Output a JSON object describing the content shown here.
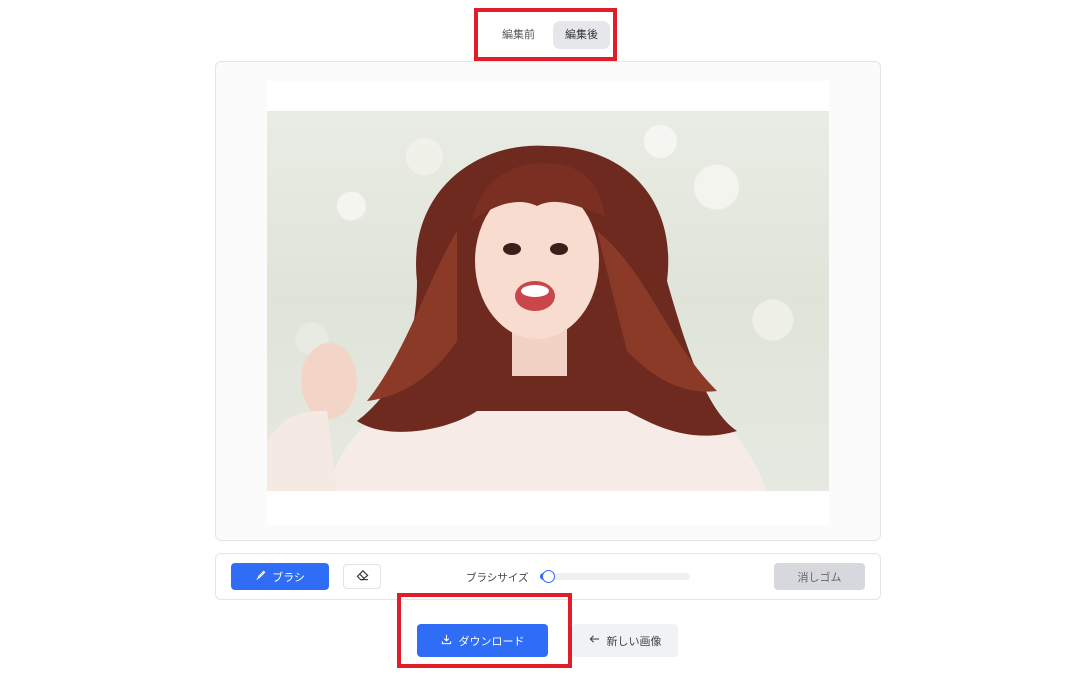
{
  "tabs": [
    {
      "label": "編集前",
      "active": false
    },
    {
      "label": "編集後",
      "active": true
    }
  ],
  "toolbar": {
    "brush_label": "ブラシ",
    "brush_icon": "brush-icon",
    "eraser_icon": "eraser-icon",
    "size_label": "ブラシサイズ",
    "size_value_fraction": 0.05,
    "clear_label": "消しゴム"
  },
  "actions": {
    "download_label": "ダウンロード",
    "download_icon": "download-icon",
    "new_image_label": "新しい画像",
    "new_image_icon": "arrow-left-icon"
  },
  "colors": {
    "accent": "#2f6df6",
    "highlight_border": "#e11d2a"
  }
}
